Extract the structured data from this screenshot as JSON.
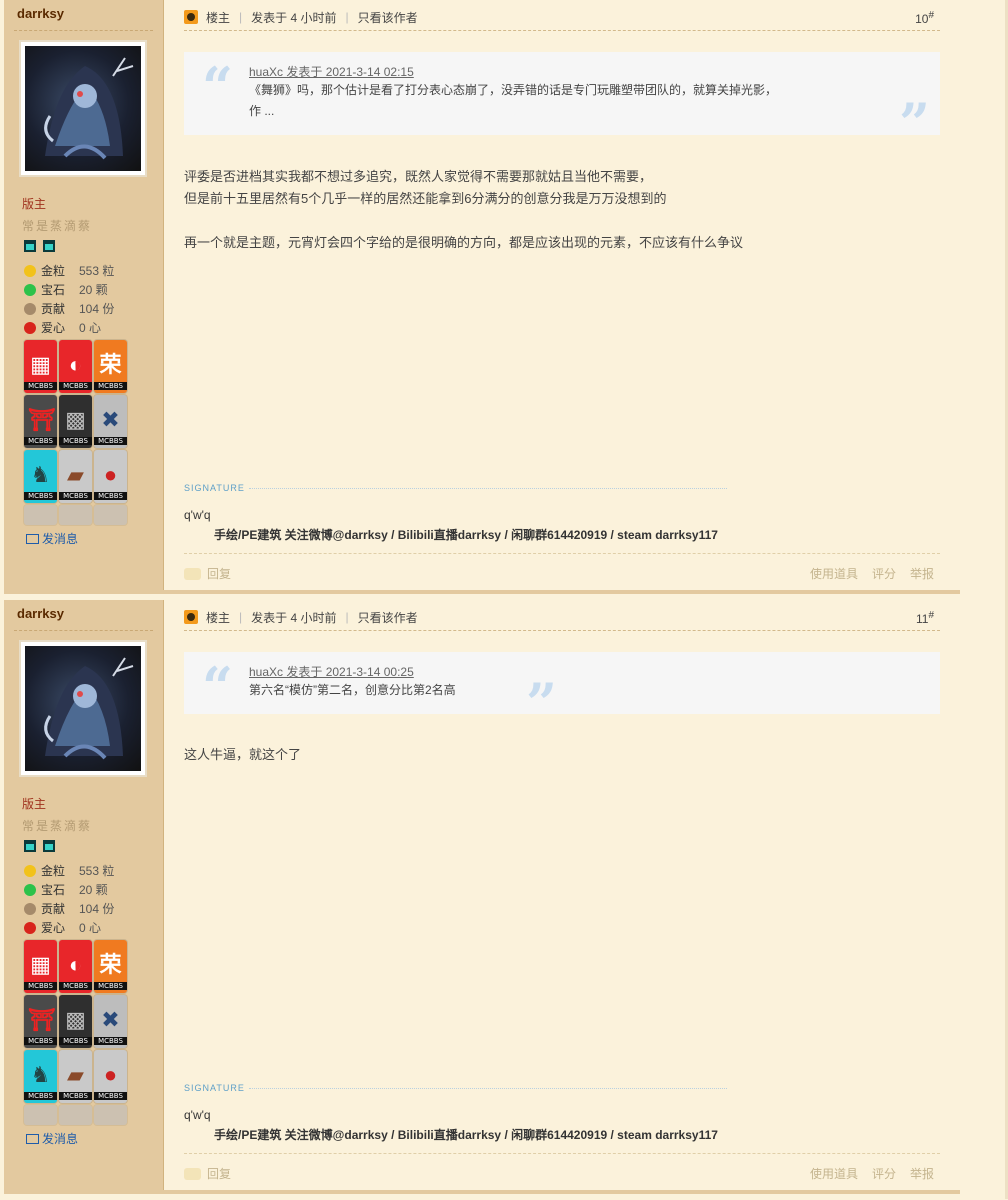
{
  "posts": [
    {
      "author": "darrksy",
      "role": "版主",
      "group": "常是蒸滴蔡",
      "stats": [
        {
          "label": "金粒",
          "value": "553 粒",
          "icon": "gold-nugget-icon",
          "color": "#f2c21a"
        },
        {
          "label": "宝石",
          "value": "20 颗",
          "icon": "emerald-icon",
          "color": "#2cc24a"
        },
        {
          "label": "贡献",
          "value": "104 份",
          "icon": "contribution-icon",
          "color": "#a58a6a"
        },
        {
          "label": "爱心",
          "value": "0 心",
          "icon": "apple-heart-icon",
          "color": "#d8241c"
        }
      ],
      "send_message": "发消息",
      "head": {
        "host": "楼主",
        "posted": "发表于 4 小时前",
        "only_author": "只看该作者",
        "floor": "10",
        "floor_mark": "#"
      },
      "quote": {
        "meta": "huaXc 发表于 2021-3-14 02:15",
        "lines": [
          "《舞狮》吗，那个估计是看了打分表心态崩了，没弄错的话是专门玩雕塑带团队的，就算关掉光影，",
          "作 ..."
        ]
      },
      "content": [
        "评委是否进档其实我都不想过多追究，既然人家觉得不需要那就姑且当他不需要，",
        "但是前十五里居然有5个几乎一样的居然还能拿到6分满分的创意分我是万万没想到的",
        "",
        "再一个就是主题，元宵灯会四个字给的是很明确的方向，都是应该出现的元素，不应该有什么争议"
      ],
      "signature_label": "SIGNATURE",
      "signature_line1": "q'w'q",
      "signature_line2": "手绘/PE建筑 关注微博@darrksy / Bilibili直播darrksy / 闲聊群614420919 / steam darrksy117",
      "footer": {
        "reply": "回复",
        "use_item": "使用道具",
        "rate": "评分",
        "report": "举报"
      }
    },
    {
      "author": "darrksy",
      "role": "版主",
      "group": "常是蒸滴蔡",
      "stats": [
        {
          "label": "金粒",
          "value": "553 粒",
          "icon": "gold-nugget-icon",
          "color": "#f2c21a"
        },
        {
          "label": "宝石",
          "value": "20 颗",
          "icon": "emerald-icon",
          "color": "#2cc24a"
        },
        {
          "label": "贡献",
          "value": "104 份",
          "icon": "contribution-icon",
          "color": "#a58a6a"
        },
        {
          "label": "爱心",
          "value": "0 心",
          "icon": "apple-heart-icon",
          "color": "#d8241c"
        }
      ],
      "send_message": "发消息",
      "head": {
        "host": "楼主",
        "posted": "发表于 4 小时前",
        "only_author": "只看该作者",
        "floor": "11",
        "floor_mark": "#"
      },
      "quote": {
        "meta": "huaXc 发表于 2021-3-14 00:25",
        "lines": [
          "第六名“模仿”第二名，创意分比第2名高"
        ]
      },
      "content": [
        "这人牛逼，就这个了"
      ],
      "signature_label": "SIGNATURE",
      "signature_line1": "q'w'q",
      "signature_line2": "手绘/PE建筑 关注微博@darrksy / Bilibili直播darrksy / 闲聊群614420919 / steam darrksy117",
      "footer": {
        "reply": "回复",
        "use_item": "使用道具",
        "rate": "评分",
        "report": "举报"
      }
    }
  ],
  "badge_tag": "MCBBS",
  "colors": {
    "sidebar": "#e3c99f",
    "page": "#fbf2db",
    "link": "#1f5caa",
    "role": "#a0321e"
  }
}
